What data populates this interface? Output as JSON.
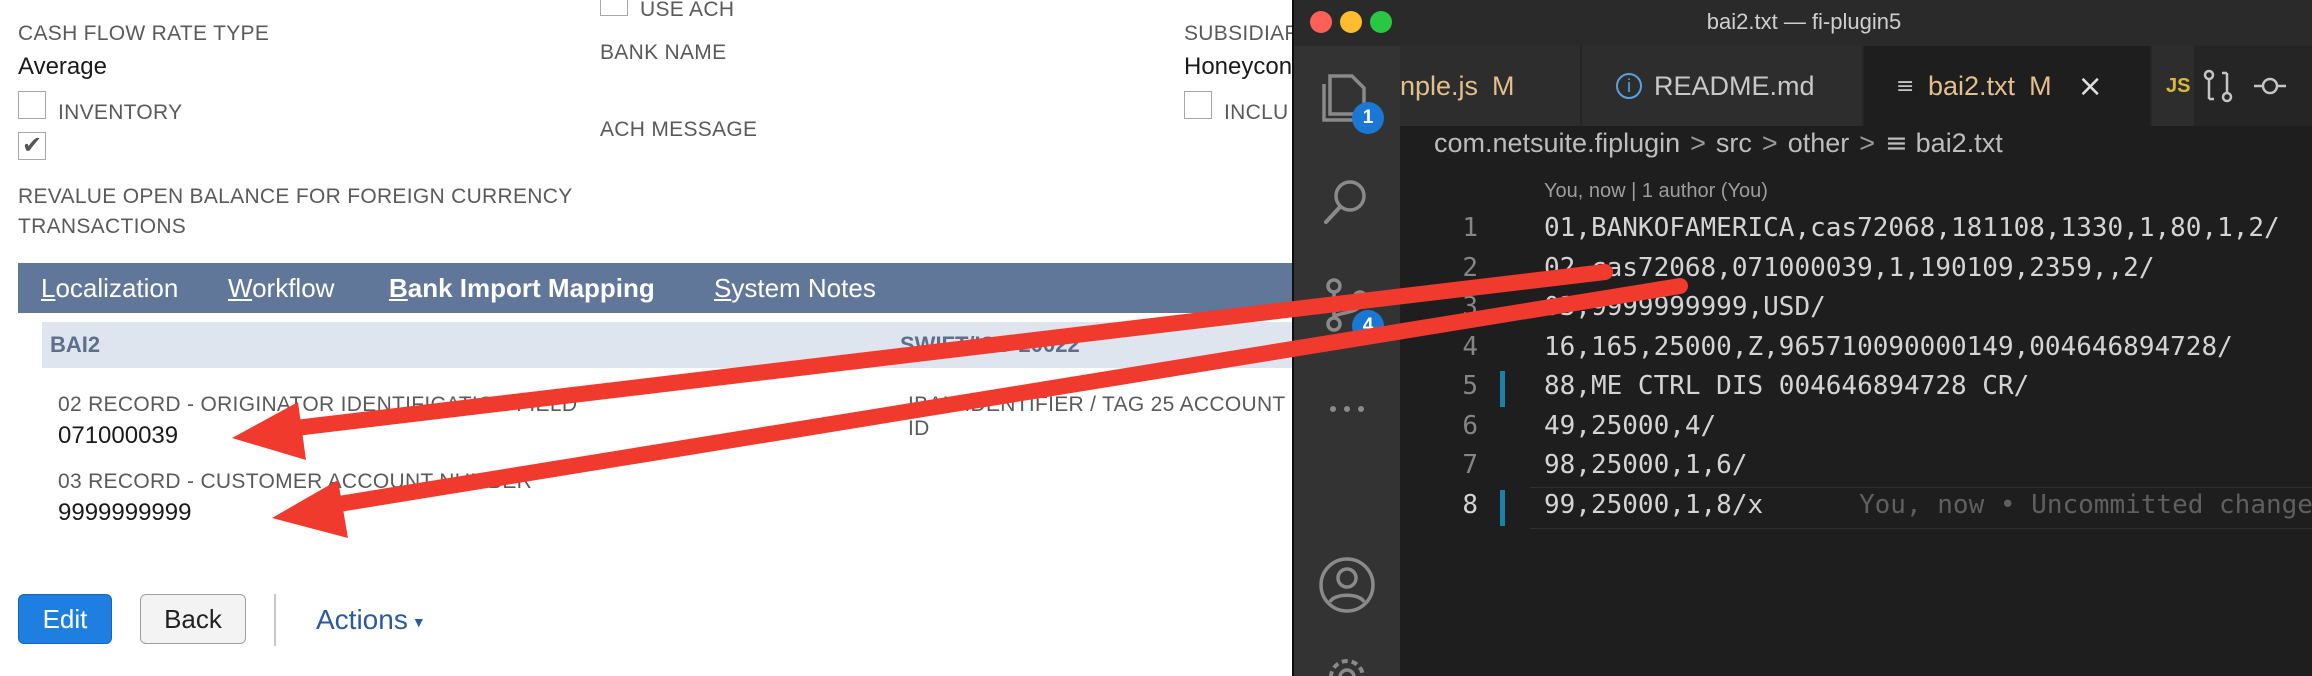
{
  "netsuite": {
    "cash_flow_label": "CASH FLOW RATE TYPE",
    "cash_flow_value": "Average",
    "inventory_label": "INVENTORY",
    "revalue_label_line1": "REVALUE OPEN BALANCE FOR FOREIGN CURRENCY",
    "revalue_label_line2": "TRANSACTIONS",
    "use_ach_label": "USE ACH",
    "bank_name_label": "BANK NAME",
    "ach_message_label": "ACH MESSAGE",
    "subsidiary_label": "SUBSIDIAR",
    "subsidiary_value": "Honeycon",
    "include_label": "INCLU",
    "tabs": [
      {
        "accel": "L",
        "rest": "ocalization"
      },
      {
        "accel": "W",
        "rest": "orkflow"
      },
      {
        "accel": "B",
        "rest": "ank Import Mapping"
      },
      {
        "accel": "S",
        "rest": "ystem Notes"
      }
    ],
    "col_bai2": "BAI2",
    "col_swift": "SWIFT/ISO 20022",
    "field1_label": "02 RECORD - ORIGINATOR IDENTIFICATION FIELD",
    "field1_value": "071000039",
    "field1_right_label": "IBAN IDENTIFIER / TAG 25 ACCOUNT ID",
    "field2_label": "03 RECORD - CUSTOMER ACCOUNT NUMBER",
    "field2_value": "9999999999",
    "edit_button": "Edit",
    "back_button": "Back",
    "actions_label": "Actions"
  },
  "vscode": {
    "window_title": "bai2.txt — fi-plugin5",
    "tabs": [
      {
        "label": "nple.js",
        "status": "M"
      },
      {
        "label": "README.md",
        "status": ""
      },
      {
        "label": "bai2.txt",
        "status": "M"
      },
      {
        "label": "JS",
        "status": ""
      }
    ],
    "explorer_badge": "1",
    "scm_badge": "4",
    "breadcrumb": [
      "com.netsuite.fiplugin",
      "src",
      "other",
      "bai2.txt"
    ],
    "blame_header": "You, now | 1 author (You)",
    "lines": [
      {
        "num": "1",
        "text": "01,BANKOFAMERICA,cas72068,181108,1330,1,80,1,2/"
      },
      {
        "num": "2",
        "text": "02,cas72068,071000039,1,190109,2359,,2/"
      },
      {
        "num": "3",
        "text": "03,9999999999,USD/"
      },
      {
        "num": "4",
        "text": "16,165,25000,Z,965710090000149,004646894728/"
      },
      {
        "num": "5",
        "text": "88,ME CTRL DIS 004646894728 CR/"
      },
      {
        "num": "6",
        "text": "49,25000,4/"
      },
      {
        "num": "7",
        "text": "98,25000,1,6/"
      },
      {
        "num": "8",
        "text": "99,25000,1,8/x"
      }
    ],
    "ghost_text": "You, now • Uncommitted change",
    "colors": {
      "arrow": "#f03a2e",
      "badge": "#1a78d4",
      "modified": "#e2c08d"
    }
  }
}
